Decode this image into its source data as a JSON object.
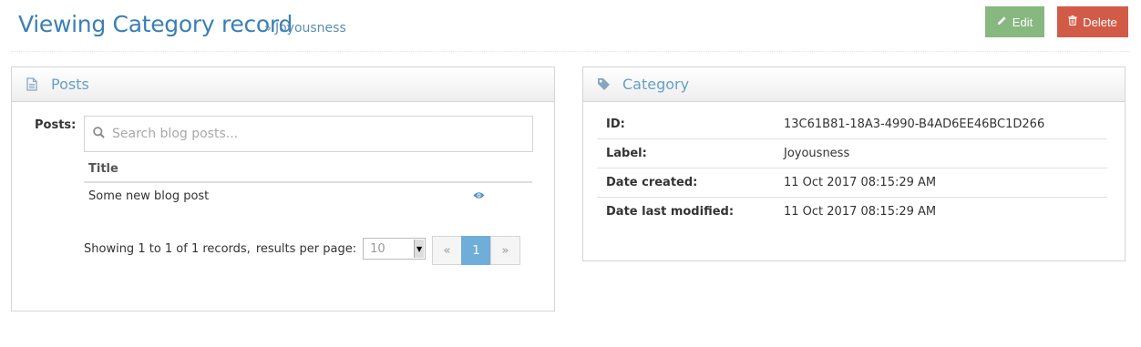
{
  "header": {
    "title": "Viewing Category record",
    "subtitle_prefix": "»",
    "subtitle": "Joyousness",
    "edit_label": "Edit",
    "delete_label": "Delete"
  },
  "colors": {
    "title": "#3a80b5",
    "edit_button": "#87b87f",
    "delete_button": "#d15b47",
    "pagination_active": "#6faed9"
  },
  "icons": {
    "edit": "pencil-icon",
    "delete": "trash-icon",
    "posts": "document-icon",
    "category": "tag-icon",
    "search": "search-icon",
    "view": "eye-icon"
  },
  "posts_panel": {
    "heading": "Posts",
    "field_label": "Posts:",
    "search_placeholder": "Search blog posts...",
    "columns": [
      "Title"
    ],
    "rows": [
      {
        "title": "Some new blog post"
      }
    ],
    "showing_text": "Showing 1 to 1 of 1 records,",
    "per_page_label": "results per page:",
    "per_page_value": "10",
    "pagination": {
      "prev": "«",
      "current": "1",
      "next": "»"
    }
  },
  "category_panel": {
    "heading": "Category",
    "fields": [
      {
        "label": "ID:",
        "value": "13C61B81-18A3-4990-B4AD6EE46BC1D266"
      },
      {
        "label": "Label:",
        "value": "Joyousness"
      },
      {
        "label": "Date created:",
        "value": "11 Oct 2017 08:15:29 AM"
      },
      {
        "label": "Date last modified:",
        "value": "11 Oct 2017 08:15:29 AM"
      }
    ]
  }
}
